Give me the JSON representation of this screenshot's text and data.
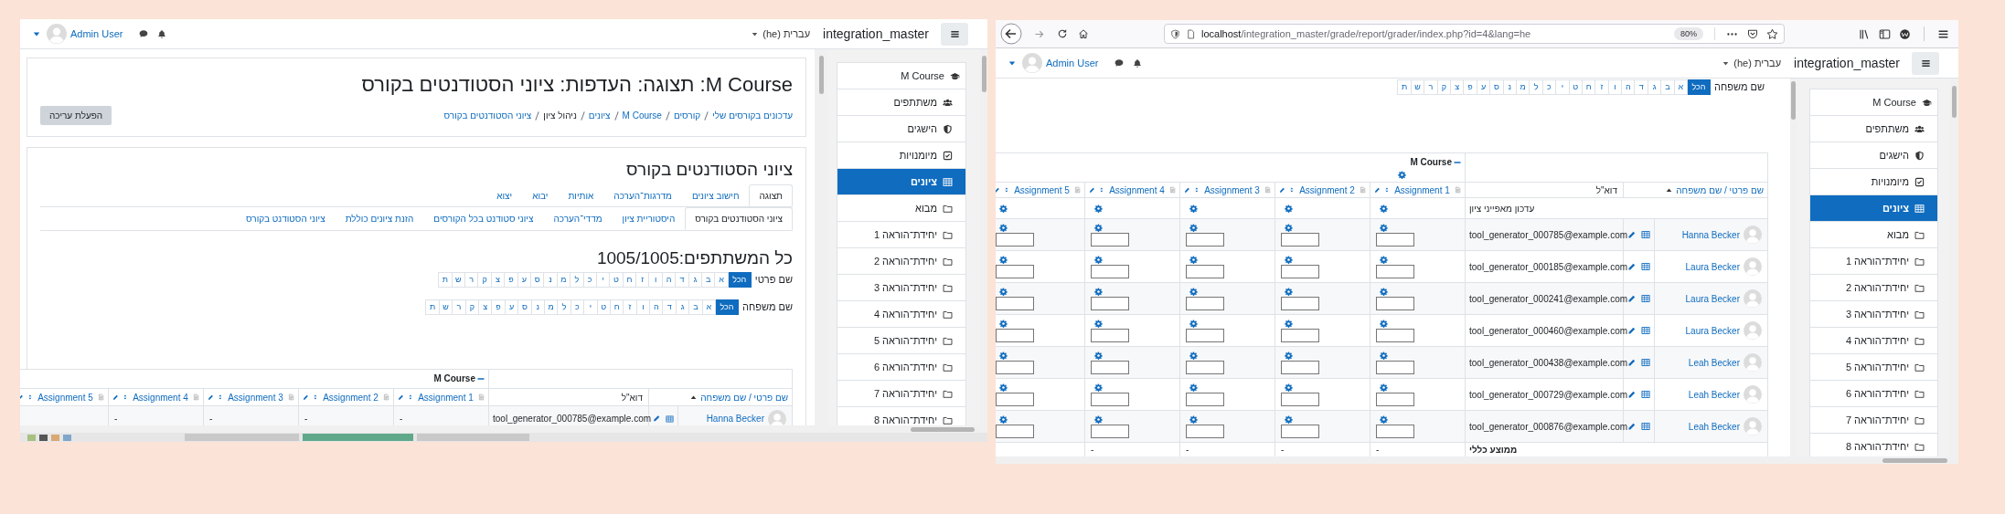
{
  "left_window": {
    "navbar": {
      "user": "Admin User",
      "language": "עברית (he)",
      "site_name": "integration_master"
    },
    "drawer": [
      {
        "label": "M Course",
        "kind": "course",
        "selected": false
      },
      {
        "label": "משתתפים",
        "kind": "participants",
        "selected": false
      },
      {
        "label": "הישגים",
        "kind": "badges",
        "selected": false
      },
      {
        "label": "מיומנויות",
        "kind": "competencies",
        "selected": false
      },
      {
        "label": "ציונים",
        "kind": "grades",
        "selected": true
      },
      {
        "label": "מבוא",
        "kind": "section",
        "selected": false
      },
      {
        "label": "יחידת־הוראה 1",
        "kind": "section",
        "selected": false
      },
      {
        "label": "יחידת־הוראה 2",
        "kind": "section",
        "selected": false
      },
      {
        "label": "יחידת־הוראה 3",
        "kind": "section",
        "selected": false
      },
      {
        "label": "יחידת־הוראה 4",
        "kind": "section",
        "selected": false
      },
      {
        "label": "יחידת־הוראה 5",
        "kind": "section",
        "selected": false
      },
      {
        "label": "יחידת־הוראה 6",
        "kind": "section",
        "selected": false
      },
      {
        "label": "יחידת־הוראה 7",
        "kind": "section",
        "selected": false
      },
      {
        "label": "יחידת־הוראה 8",
        "kind": "section",
        "selected": false
      }
    ],
    "header": {
      "title": "M Course: תצוגה: העדפות: ציוני הסטודנטים בקורס",
      "edit_button": "הפעלת עריכה",
      "breadcrumb": [
        {
          "label": "עדכונים בקורסים שלי",
          "link": true
        },
        {
          "label": "קורסים",
          "link": true
        },
        {
          "label": "M Course",
          "link": true
        },
        {
          "label": "ציונים",
          "link": true
        },
        {
          "label": "ניהול ציון",
          "link": false
        },
        {
          "label": "ציוני הסטודנטים בקורס",
          "link": true
        }
      ]
    },
    "heading": "ציוני הסטודנטים בקורס",
    "tabs": [
      {
        "label": "תצוגה",
        "selected": true
      },
      {
        "label": "חישוב ציונים",
        "selected": false
      },
      {
        "label": "מדרגות־הערכה",
        "selected": false
      },
      {
        "label": "אותיות",
        "selected": false
      },
      {
        "label": "יבוא",
        "selected": false
      },
      {
        "label": "יצוא",
        "selected": false
      }
    ],
    "subtabs": [
      {
        "label": "ציוני הסטודנטים בקורס",
        "selected": true
      },
      {
        "label": "היסטוריית ציון",
        "selected": false
      },
      {
        "label": "מדדי־הערכה",
        "selected": false
      },
      {
        "label": "ציוני סטודנט בכל הקורסים",
        "selected": false
      },
      {
        "label": "הזנת ציונים כוללת",
        "selected": false
      },
      {
        "label": "ציוני הסטודנט בקורס",
        "selected": false
      }
    ],
    "participants": "כל המשתתפים:1005/1005",
    "first_name_filter": {
      "label": "שם פרטי",
      "letters": [
        {
          "label": "הכל",
          "selected": true
        },
        {
          "label": "א",
          "selected": false
        },
        {
          "label": "ב",
          "selected": false
        },
        {
          "label": "ג",
          "selected": false
        },
        {
          "label": "ד",
          "selected": false
        },
        {
          "label": "ה",
          "selected": false
        },
        {
          "label": "ו",
          "selected": false
        },
        {
          "label": "ז",
          "selected": false
        },
        {
          "label": "ח",
          "selected": false
        },
        {
          "label": "ט",
          "selected": false
        },
        {
          "label": "י",
          "selected": false
        },
        {
          "label": "כ",
          "selected": false
        },
        {
          "label": "ל",
          "selected": false
        },
        {
          "label": "מ",
          "selected": false
        },
        {
          "label": "נ",
          "selected": false
        },
        {
          "label": "ס",
          "selected": false
        },
        {
          "label": "ע",
          "selected": false
        },
        {
          "label": "פ",
          "selected": false
        },
        {
          "label": "צ",
          "selected": false
        },
        {
          "label": "ק",
          "selected": false
        },
        {
          "label": "ר",
          "selected": false
        },
        {
          "label": "ש",
          "selected": false
        },
        {
          "label": "ת",
          "selected": false
        }
      ]
    },
    "last_name_filter": {
      "label": "שם משפחה",
      "letters": [
        {
          "label": "הכל",
          "selected": true
        },
        {
          "label": "א",
          "selected": false
        },
        {
          "label": "ב",
          "selected": false
        },
        {
          "label": "ג",
          "selected": false
        },
        {
          "label": "ד",
          "selected": false
        },
        {
          "label": "ה",
          "selected": false
        },
        {
          "label": "ו",
          "selected": false
        },
        {
          "label": "ז",
          "selected": false
        },
        {
          "label": "ח",
          "selected": false
        },
        {
          "label": "ט",
          "selected": false
        },
        {
          "label": "י",
          "selected": false
        },
        {
          "label": "כ",
          "selected": false
        },
        {
          "label": "ל",
          "selected": false
        },
        {
          "label": "מ",
          "selected": false
        },
        {
          "label": "נ",
          "selected": false
        },
        {
          "label": "ס",
          "selected": false
        },
        {
          "label": "ע",
          "selected": false
        },
        {
          "label": "פ",
          "selected": false
        },
        {
          "label": "צ",
          "selected": false
        },
        {
          "label": "ק",
          "selected": false
        },
        {
          "label": "ר",
          "selected": false
        },
        {
          "label": "ש",
          "selected": false
        },
        {
          "label": "ת",
          "selected": false
        }
      ]
    },
    "grader": {
      "course": "M Course",
      "name_column": "שם פרטי / שם משפחה",
      "email_column": "דוא\"ל",
      "editing": false,
      "items": [
        "Assignment 1",
        "Assignment 2",
        "Assignment 3",
        "Assignment 4",
        "Assignment 5"
      ],
      "rows": [
        {
          "name": "Hanna Becker",
          "email": "tool_generator_000785@example.com",
          "grades": [
            "-",
            "-",
            "-",
            "-"
          ]
        }
      ]
    }
  },
  "right_window": {
    "browser": {
      "url": "localhost/integration_master/grade/report/grader/index.php?id=4&lang=he",
      "zoom": "80%"
    },
    "navbar": {
      "user": "Admin User",
      "language": "עברית (he)",
      "site_name": "integration_master"
    },
    "drawer": [
      {
        "label": "M Course",
        "kind": "course",
        "selected": false
      },
      {
        "label": "משתתפים",
        "kind": "participants",
        "selected": false
      },
      {
        "label": "הישגים",
        "kind": "badges",
        "selected": false
      },
      {
        "label": "מיומנויות",
        "kind": "competencies",
        "selected": false
      },
      {
        "label": "ציונים",
        "kind": "grades",
        "selected": true
      },
      {
        "label": "מבוא",
        "kind": "section",
        "selected": false
      },
      {
        "label": "יחידת־הוראה 1",
        "kind": "section",
        "selected": false
      },
      {
        "label": "יחידת־הוראה 2",
        "kind": "section",
        "selected": false
      },
      {
        "label": "יחידת־הוראה 3",
        "kind": "section",
        "selected": false
      },
      {
        "label": "יחידת־הוראה 4",
        "kind": "section",
        "selected": false
      },
      {
        "label": "יחידת־הוראה 5",
        "kind": "section",
        "selected": false
      },
      {
        "label": "יחידת־הוראה 6",
        "kind": "section",
        "selected": false
      },
      {
        "label": "יחידת־הוראה 7",
        "kind": "section",
        "selected": false
      },
      {
        "label": "יחידת־הוראה 8",
        "kind": "section",
        "selected": false
      }
    ],
    "last_name_filter": {
      "label": "שם משפחה",
      "letters": [
        {
          "label": "הכל",
          "selected": true
        },
        {
          "label": "א",
          "selected": false
        },
        {
          "label": "ב",
          "selected": false
        },
        {
          "label": "ג",
          "selected": false
        },
        {
          "label": "ד",
          "selected": false
        },
        {
          "label": "ה",
          "selected": false
        },
        {
          "label": "ו",
          "selected": false
        },
        {
          "label": "ז",
          "selected": false
        },
        {
          "label": "ח",
          "selected": false
        },
        {
          "label": "ט",
          "selected": false
        },
        {
          "label": "י",
          "selected": false
        },
        {
          "label": "כ",
          "selected": false
        },
        {
          "label": "ל",
          "selected": false
        },
        {
          "label": "מ",
          "selected": false
        },
        {
          "label": "נ",
          "selected": false
        },
        {
          "label": "ס",
          "selected": false
        },
        {
          "label": "ע",
          "selected": false
        },
        {
          "label": "פ",
          "selected": false
        },
        {
          "label": "צ",
          "selected": false
        },
        {
          "label": "ק",
          "selected": false
        },
        {
          "label": "ר",
          "selected": false
        },
        {
          "label": "ש",
          "selected": false
        },
        {
          "label": "ת",
          "selected": false
        }
      ]
    },
    "grader": {
      "course": "M Course",
      "name_column": "שם פרטי / שם משפחה",
      "email_column": "דוא\"ל",
      "editing": true,
      "items": [
        "Assignment 1",
        "Assignment 2",
        "Assignment 3",
        "Assignment 4",
        "Assignment 5"
      ],
      "settings_row": "עדכון מאפייני ציון",
      "rows": [
        {
          "name": "Hanna Becker",
          "email": "tool_generator_000785@example.com"
        },
        {
          "name": "Laura Becker",
          "email": "tool_generator_000185@example.com"
        },
        {
          "name": "Laura Becker",
          "email": "tool_generator_000241@example.com"
        },
        {
          "name": "Laura Becker",
          "email": "tool_generator_000460@example.com"
        },
        {
          "name": "Leah Becker",
          "email": "tool_generator_000438@example.com"
        },
        {
          "name": "Leah Becker",
          "email": "tool_generator_000729@example.com"
        },
        {
          "name": "Leah Becker",
          "email": "tool_generator_000876@example.com"
        }
      ],
      "average_row": {
        "label": "ממוצע כללי",
        "values": [
          "-",
          "-",
          "-",
          "-"
        ]
      }
    }
  }
}
